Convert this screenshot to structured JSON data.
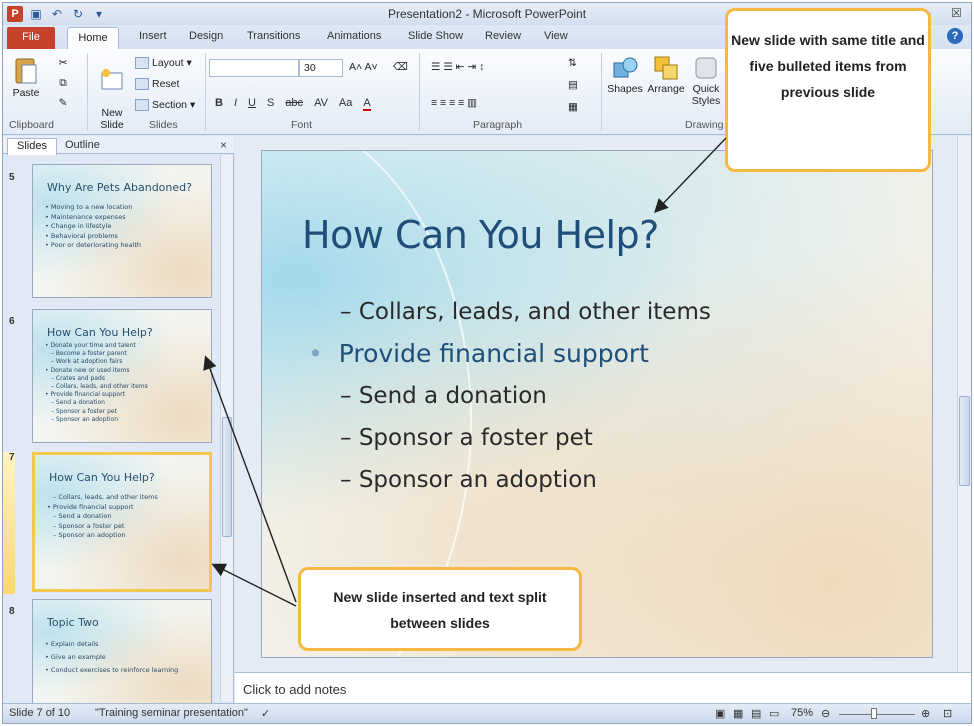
{
  "window": {
    "title": "Presentation2 - Microsoft PowerPoint",
    "app_icon_label": "P",
    "min_label": "–",
    "close_label": "☒"
  },
  "tabs": {
    "file": "File",
    "home": "Home",
    "insert": "Insert",
    "design": "Design",
    "transitions": "Transitions",
    "animations": "Animations",
    "slide_show": "Slide Show",
    "review": "Review",
    "view": "View"
  },
  "ribbon": {
    "clipboard": {
      "paste": "Paste",
      "label": "Clipboard"
    },
    "slides": {
      "new_slide": "New\nSlide",
      "layout": "Layout",
      "reset": "Reset",
      "section": "Section",
      "label": "Slides"
    },
    "font": {
      "size": "30",
      "label": "Font",
      "formats": [
        "B",
        "I",
        "U",
        "S",
        "abc",
        "AV",
        "Aa",
        "A"
      ]
    },
    "paragraph": {
      "label": "Paragraph"
    },
    "drawing": {
      "shapes": "Shapes",
      "arrange": "Arrange",
      "quick_styles": "Quick Styles",
      "label": "Drawing"
    }
  },
  "slides_pane": {
    "tab_slides": "Slides",
    "tab_outline": "Outline",
    "close": "×",
    "thumbnails": [
      {
        "number": "5",
        "title": "Why Are Pets Abandoned?",
        "lines": [
          {
            "text": "Moving to a new location",
            "level": 1
          },
          {
            "text": "Maintenance expenses",
            "level": 1
          },
          {
            "text": "Change in lifestyle",
            "level": 1
          },
          {
            "text": "Behavioral problems",
            "level": 1
          },
          {
            "text": "Poor or deteriorating health",
            "level": 1
          }
        ]
      },
      {
        "number": "6",
        "title": "How Can You Help?",
        "lines": [
          {
            "text": "Donate your time and talent",
            "level": 1
          },
          {
            "text": "Become a foster parent",
            "level": 2
          },
          {
            "text": "Work at adoption fairs",
            "level": 2
          },
          {
            "text": "Donate new or used items",
            "level": 1
          },
          {
            "text": "Crates and pads",
            "level": 2
          },
          {
            "text": "Collars, leads, and other items",
            "level": 2
          },
          {
            "text": "Provide financial support",
            "level": 1
          },
          {
            "text": "Send a donation",
            "level": 2
          },
          {
            "text": "Sponsor a foster pet",
            "level": 2
          },
          {
            "text": "Sponsor an adoption",
            "level": 2
          }
        ]
      },
      {
        "number": "7",
        "title": "How Can You Help?",
        "selected": true,
        "lines": [
          {
            "text": "Collars, leads, and other items",
            "level": 2
          },
          {
            "text": "Provide financial support",
            "level": 1
          },
          {
            "text": "Send a donation",
            "level": 2
          },
          {
            "text": "Sponsor a foster pet",
            "level": 2
          },
          {
            "text": "Sponsor an adoption",
            "level": 2
          }
        ]
      },
      {
        "number": "8",
        "title": "Topic Two",
        "lines": [
          {
            "text": "Explain details",
            "level": 1
          },
          {
            "text": "Give an example",
            "level": 1
          },
          {
            "text": "Conduct exercises to reinforce learning",
            "level": 1
          }
        ]
      }
    ]
  },
  "slide": {
    "title": "How Can You Help?",
    "items": [
      {
        "text": "Collars, leads, and other items",
        "level": 2
      },
      {
        "text": "Provide financial support",
        "level": 1
      },
      {
        "text": "Send a donation",
        "level": 2
      },
      {
        "text": "Sponsor a foster pet",
        "level": 2
      },
      {
        "text": "Sponsor an adoption",
        "level": 2
      }
    ]
  },
  "notes": {
    "placeholder": "Click to add notes"
  },
  "status_bar": {
    "slide_position": "Slide 7 of 10",
    "theme": "\"Training seminar presentation\"",
    "zoom": "75%"
  },
  "callouts": {
    "top": "New slide with same title and five bulleted items from previous slide",
    "bottom": "New slide inserted and text split between slides"
  },
  "colors": {
    "file_tab": "#c5432a",
    "callout_border": "#f5b942",
    "slide_title": "#1f4e79",
    "selection": "#f2c94c"
  }
}
